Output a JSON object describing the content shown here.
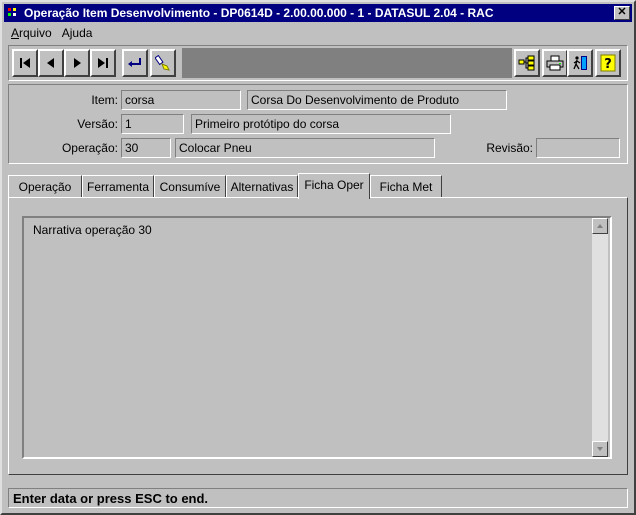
{
  "window": {
    "title": "Operação Item Desenvolvimento - DP0614D - 2.00.00.000 - 1 - DATASUL 2.04 - RAC",
    "close": "✕"
  },
  "menu": {
    "file": {
      "accel": "A",
      "rest": "rquivo"
    },
    "help": {
      "pre": "A",
      "accel": "j",
      "rest": "uda"
    }
  },
  "header": {
    "item_label": "Item:",
    "item_code": "corsa",
    "item_desc": "Corsa Do Desenvolvimento de Produto",
    "version_label": "Versão:",
    "version_code": "1",
    "version_desc": "Primeiro protótipo do corsa",
    "operation_label": "Operação:",
    "operation_code": "30",
    "operation_desc": "Colocar Pneu",
    "revision_label": "Revisão:",
    "revision_value": ""
  },
  "tabs": [
    "Operação",
    "Ferramenta",
    "Consumíve",
    "Alternativas",
    "Ficha Oper",
    "Ficha Met"
  ],
  "active_tab": "Ficha Oper",
  "editor": {
    "text": "Narrativa operação 30"
  },
  "status": {
    "text": "Enter data or press ESC to end."
  },
  "toolbar_icons": [
    "first-record-icon",
    "previous-record-icon",
    "next-record-icon",
    "last-record-icon",
    "goto-icon",
    "search-icon",
    "zoom-tree-icon",
    "print-icon",
    "exit-icon",
    "help-icon"
  ]
}
